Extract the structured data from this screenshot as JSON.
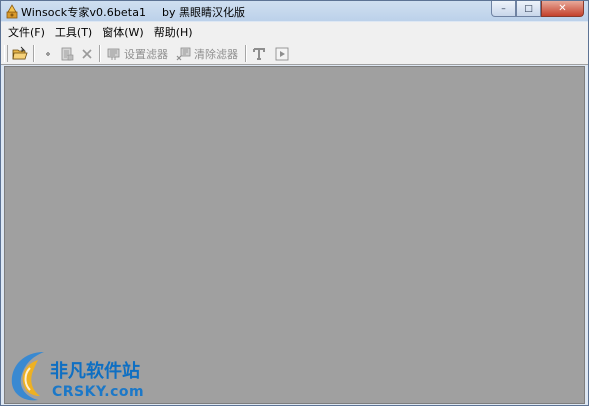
{
  "window": {
    "title": "Winsock专家v0.6beta1",
    "title_credit": "by 黑眼睛汉化版",
    "controls": {
      "minimize": "–",
      "maximize": "□",
      "close": "✕"
    }
  },
  "menu": {
    "items": [
      {
        "label": "文件(F)"
      },
      {
        "label": "工具(T)"
      },
      {
        "label": "窗体(W)"
      },
      {
        "label": "帮助(H)"
      }
    ]
  },
  "toolbar": {
    "icons": [
      "open-folder-icon",
      "pin-icon",
      "document-icon",
      "close-x-icon",
      "filter-icon",
      "clear-filter-icon",
      "text-icon",
      "play-icon"
    ],
    "set_filter_label": "设置滤器",
    "clear_filter_label": "清除滤器"
  },
  "watermark": {
    "main": "非凡软件站",
    "sub": "CRSKY.com"
  },
  "colors": {
    "client_background": "#a0a0a0",
    "titlebar": "#c3d6ec",
    "watermark_blue": "#0e6fc3"
  }
}
